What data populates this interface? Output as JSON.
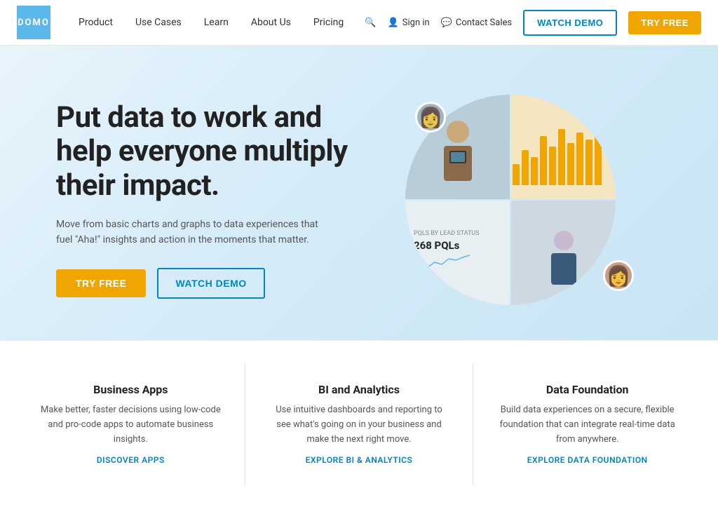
{
  "navbar": {
    "logo_text": "DOMO",
    "nav_items": [
      {
        "label": "Product",
        "id": "product"
      },
      {
        "label": "Use Cases",
        "id": "use-cases"
      },
      {
        "label": "Learn",
        "id": "learn"
      },
      {
        "label": "About Us",
        "id": "about-us"
      },
      {
        "label": "Pricing",
        "id": "pricing"
      }
    ],
    "search_label": "🔍",
    "signin_label": "Sign in",
    "contact_label": "Contact Sales",
    "watch_demo_label": "WATCH DEMO",
    "try_free_label": "TRY FREE"
  },
  "hero": {
    "title": "Put data to work and help everyone multiply their impact.",
    "subtitle": "Move from basic charts and graphs to data experiences that fuel \"Aha!\" insights and action in the moments that matter.",
    "try_free_label": "TRY FREE",
    "watch_demo_label": "WATCH DEMO",
    "stat_label": "PQLS BY LEAD STATUS",
    "stat_value": "268 PQLs"
  },
  "cards": [
    {
      "title": "Business Apps",
      "desc": "Make better, faster decisions using low-code and pro-code apps to automate business insights.",
      "link_label": "DISCOVER APPS",
      "link_id": "discover-apps"
    },
    {
      "title": "BI and Analytics",
      "desc": "Use intuitive dashboards and reporting to see what's going on in your business and make the next right move.",
      "link_label": "EXPLORE BI & ANALYTICS",
      "link_id": "explore-bi"
    },
    {
      "title": "Data Foundation",
      "desc": "Build data experiences on a secure, flexible foundation that can integrate real-time data from anywhere.",
      "link_label": "EXPLORE DATA FOUNDATION",
      "link_id": "explore-data"
    }
  ],
  "bars": [
    30,
    50,
    40,
    70,
    55,
    80,
    60,
    75,
    65,
    90
  ]
}
